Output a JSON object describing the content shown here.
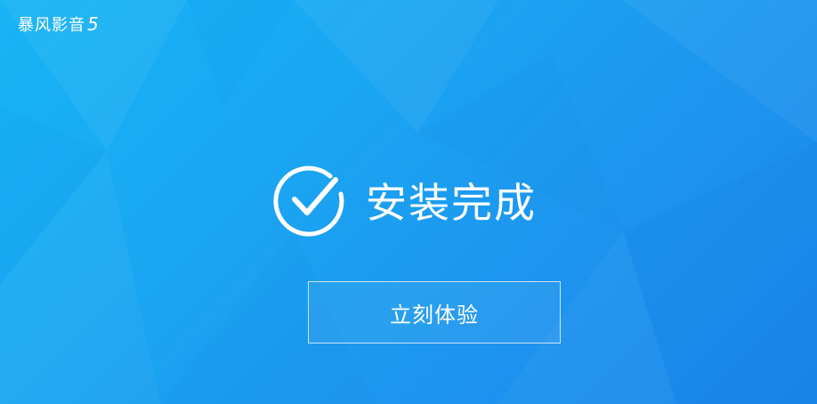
{
  "window": {
    "brand_name": "暴风影音",
    "brand_version": "5"
  },
  "status": {
    "icon": "check-circle-icon",
    "text": "安装完成"
  },
  "actions": {
    "start_label": "立刻体验"
  },
  "colors": {
    "background_light": "#17b4f5",
    "background_dark": "#1a86ea",
    "foreground": "#ffffff"
  }
}
